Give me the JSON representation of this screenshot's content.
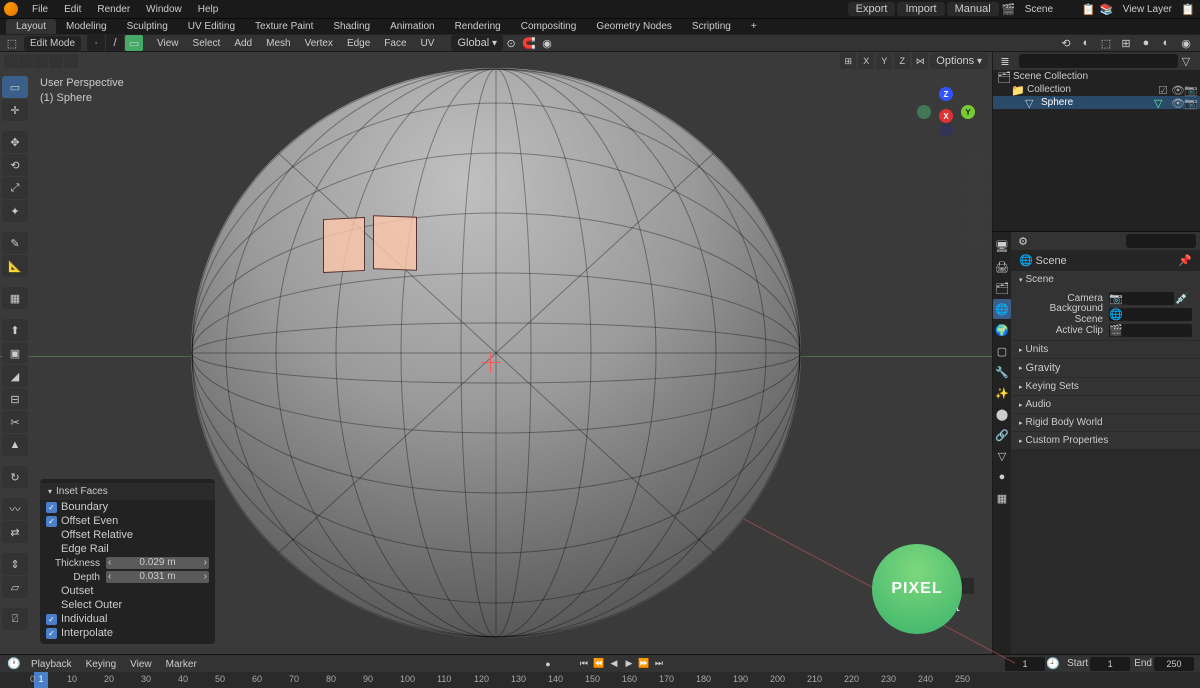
{
  "topmenu": [
    "File",
    "Edit",
    "Render",
    "Window",
    "Help"
  ],
  "top_buttons": {
    "export": "Export",
    "import": "Import",
    "manual": "Manual"
  },
  "scene_field": "Scene",
  "viewlayer_field": "View Layer",
  "workspaces": [
    "Layout",
    "Modeling",
    "Sculpting",
    "UV Editing",
    "Texture Paint",
    "Shading",
    "Animation",
    "Rendering",
    "Compositing",
    "Geometry Nodes",
    "Scripting"
  ],
  "active_workspace": 0,
  "header": {
    "mode": "Edit Mode",
    "menus": [
      "View",
      "Select",
      "Add",
      "Mesh",
      "Vertex",
      "Edge",
      "Face",
      "UV"
    ],
    "orientation": "Global"
  },
  "viewport": {
    "overlay_line1": "User Perspective",
    "overlay_line2": "(1) Sphere",
    "options": "Options",
    "axes": [
      "X",
      "Y",
      "Z"
    ],
    "shading_label": "Left"
  },
  "gizmo": {
    "x": "X",
    "y": "Y",
    "z": "Z"
  },
  "op_panel": {
    "title": "Inset Faces",
    "boundary": "Boundary",
    "offset_even": "Offset Even",
    "offset_relative": "Offset Relative",
    "edge_rail": "Edge Rail",
    "thickness_label": "Thickness",
    "thickness": "0.029 m",
    "depth_label": "Depth",
    "depth": "0.031 m",
    "outset": "Outset",
    "select_outer": "Select Outer",
    "individual": "Individual",
    "interpolate": "Interpolate"
  },
  "outliner": {
    "scene_collection": "Scene Collection",
    "collection": "Collection",
    "sphere": "Sphere"
  },
  "properties": {
    "crumb": "Scene",
    "scene_panel": "Scene",
    "camera_label": "Camera",
    "bgscene_label": "Background Scene",
    "activeclip_label": "Active Clip",
    "sections": [
      "Units",
      "Gravity",
      "Keying Sets",
      "Audio",
      "Rigid Body World",
      "Custom Properties"
    ]
  },
  "timeline": {
    "menus": [
      "Playback",
      "Keying",
      "View",
      "Marker"
    ],
    "start_label": "Start",
    "end_label": "End",
    "frame": "1",
    "start": "1",
    "end": "250",
    "ticks": [
      "0",
      "10",
      "20",
      "30",
      "40",
      "50",
      "60",
      "70",
      "80",
      "90",
      "100",
      "110",
      "120",
      "130",
      "140",
      "150",
      "160",
      "170",
      "180",
      "190",
      "200",
      "210",
      "220",
      "230",
      "240",
      "250"
    ]
  },
  "brand": "PIXEL"
}
